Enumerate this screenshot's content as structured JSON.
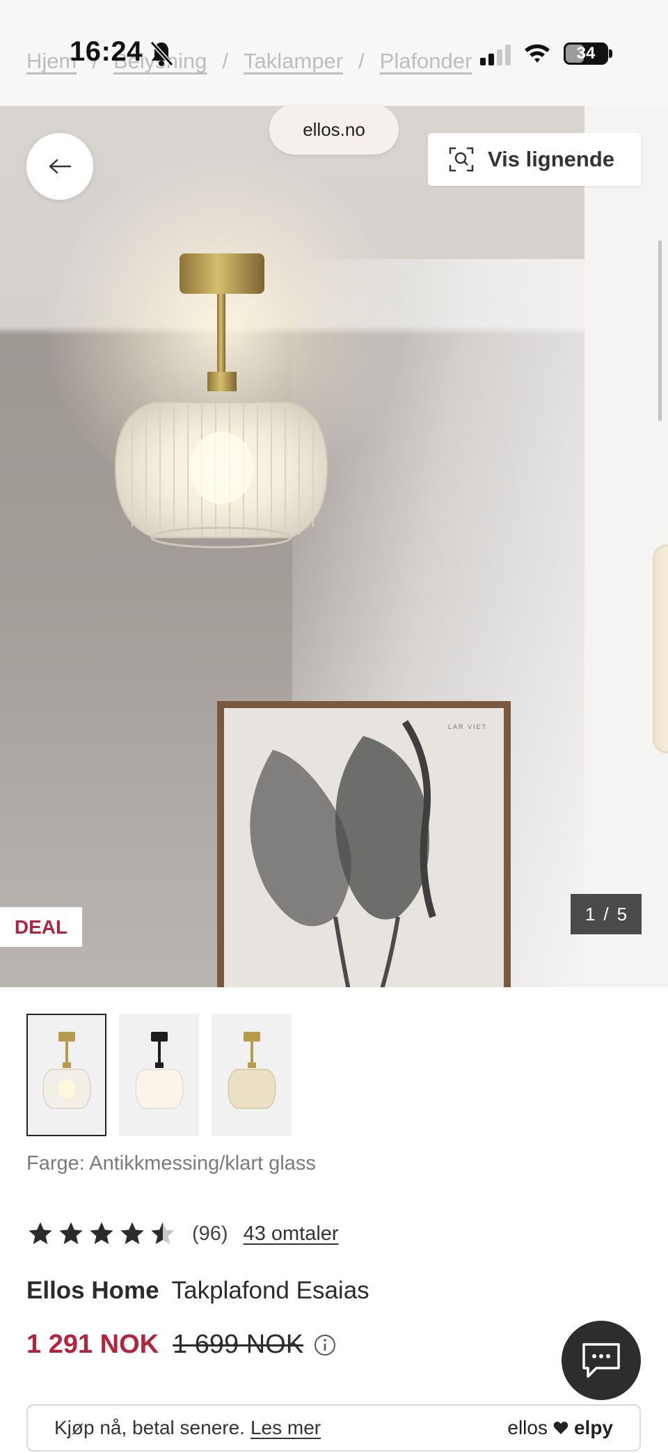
{
  "status_bar": {
    "time": "16:24",
    "battery": "34"
  },
  "breadcrumb": [
    "Hjem",
    "Belysning",
    "Taklamper",
    "Plafonder"
  ],
  "browser": {
    "url": "ellos.no"
  },
  "gallery": {
    "similar_label": "Vis lignende",
    "deal_label": "DEAL",
    "counter_current": "1",
    "counter_sep": "/",
    "counter_total": "5"
  },
  "product": {
    "color_line": "Farge: Antikkmessing/klart glass",
    "rating_value": 4.5,
    "rating_count": "(96)",
    "reviews_link": "43 omtaler",
    "brand": "Ellos Home",
    "name": "Takplafond Esaias",
    "price_now": "1 291 NOK",
    "price_old": "1 699 NOK"
  },
  "payment": {
    "text": "Kjøp nå, betal senere.",
    "link": "Les mer",
    "brand_a": "ellos",
    "brand_b": "elpy"
  },
  "colors": {
    "accent_red": "#b3233a",
    "dark": "#2d2d2d"
  }
}
